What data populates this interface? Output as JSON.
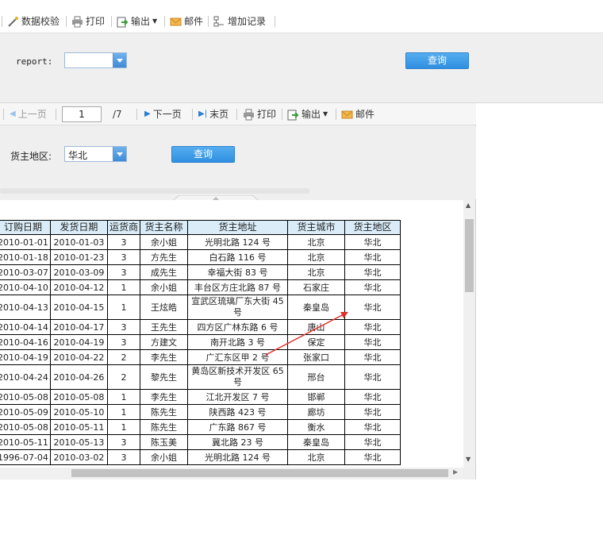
{
  "top_toolbar": {
    "items": [
      {
        "label": "数据校验",
        "icon": "validate-icon"
      },
      {
        "label": "打印",
        "icon": "printer-icon"
      },
      {
        "label": "输出",
        "icon": "export-icon"
      },
      {
        "label": "邮件",
        "icon": "mail-icon"
      },
      {
        "label": "增加记录",
        "icon": "add-record-icon"
      }
    ]
  },
  "param1": {
    "label": "report:",
    "combo_value": "",
    "query_label": "查询"
  },
  "nav": {
    "prev_label": "上一页",
    "page_value": "1",
    "page_total": "/7",
    "next_label": "下一页",
    "last_label": "末页",
    "print_label": "打印",
    "export_label": "输出",
    "mail_label": "邮件"
  },
  "param2": {
    "label": "货主地区:",
    "combo_value": "华北",
    "query_label": "查询"
  },
  "table": {
    "headers": [
      "订购日期",
      "发货日期",
      "运货商",
      "货主名称",
      "货主地址",
      "货主城市",
      "货主地区"
    ],
    "rows": [
      [
        "2010-01-01",
        "2010-01-03",
        "3",
        "余小姐",
        "光明北路 124 号",
        "北京",
        "华北"
      ],
      [
        "2010-01-18",
        "2010-01-23",
        "3",
        "方先生",
        "白石路 116 号",
        "北京",
        "华北"
      ],
      [
        "2010-03-07",
        "2010-03-09",
        "3",
        "成先生",
        "幸福大街 83 号",
        "北京",
        "华北"
      ],
      [
        "2010-04-10",
        "2010-04-12",
        "1",
        "余小姐",
        "丰台区方庄北路 87 号",
        "石家庄",
        "华北"
      ],
      [
        "2010-04-13",
        "2010-04-15",
        "1",
        "王炫皓",
        "宣武区琉璃厂东大街 45 号",
        "秦皇岛",
        "华北"
      ],
      [
        "2010-04-14",
        "2010-04-17",
        "3",
        "王先生",
        "四方区广林东路 6 号",
        "唐山",
        "华北"
      ],
      [
        "2010-04-16",
        "2010-04-19",
        "3",
        "方建文",
        "南开北路 3 号",
        "保定",
        "华北"
      ],
      [
        "2010-04-19",
        "2010-04-22",
        "2",
        "李先生",
        "广汇东区甲 2 号",
        "张家口",
        "华北"
      ],
      [
        "2010-04-24",
        "2010-04-26",
        "2",
        "黎先生",
        "黄岛区新技术开发区 65 号",
        "邢台",
        "华北"
      ],
      [
        "2010-05-08",
        "2010-05-08",
        "1",
        "李先生",
        "江北开发区 7 号",
        "邯郸",
        "华北"
      ],
      [
        "2010-05-09",
        "2010-05-10",
        "1",
        "陈先生",
        "陕西路 423 号",
        "廊坊",
        "华北"
      ],
      [
        "2010-05-08",
        "2010-05-11",
        "1",
        "陈先生",
        "广东路 867 号",
        "衡水",
        "华北"
      ],
      [
        "2010-05-11",
        "2010-05-13",
        "3",
        "陈玉美",
        "冀北路 23 号",
        "秦皇岛",
        "华北"
      ],
      [
        "1996-07-04",
        "2010-03-02",
        "3",
        "余小姐",
        "光明北路 124 号",
        "北京",
        "华北"
      ]
    ]
  },
  "colors": {
    "accent": "#3a93e2",
    "table_header_bg": "#d9ecf8",
    "annotation_arrow": "#e0302a"
  }
}
